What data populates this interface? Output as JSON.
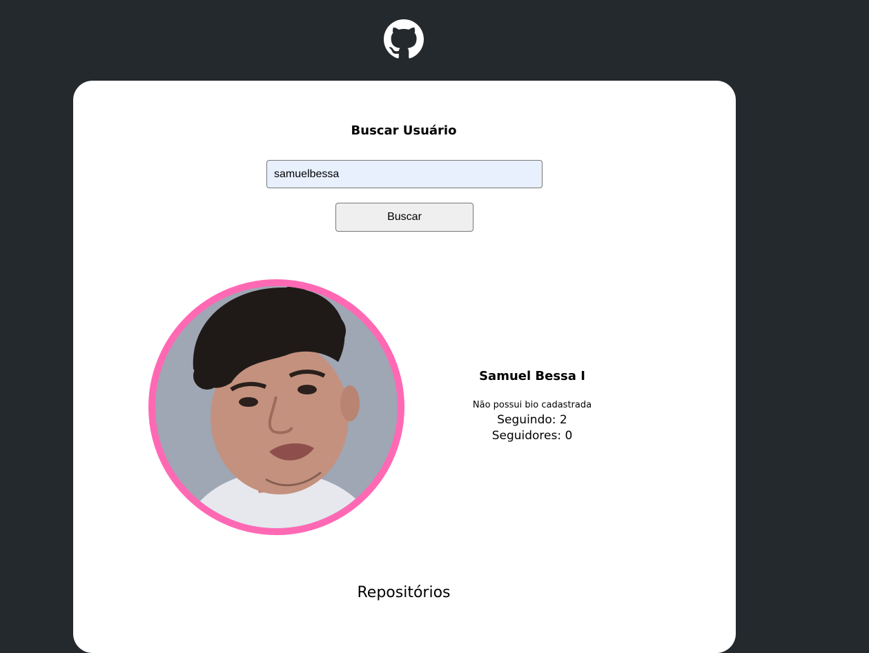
{
  "header": {
    "logo_icon": "github-icon"
  },
  "search": {
    "title": "Buscar Usuário",
    "input_value": "samuelbessa",
    "button_label": "Buscar"
  },
  "profile": {
    "avatar_border_color": "#ff69b4",
    "name": "Samuel Bessa I",
    "bio": "Não possui bio cadastrada",
    "following": "Seguindo: 2",
    "followers": "Seguidores: 0"
  },
  "repositories": {
    "title": "Repositórios"
  },
  "colors": {
    "background": "#24292e",
    "card": "#ffffff",
    "input_bg": "#e8f0fe",
    "button_bg": "#efefef"
  }
}
